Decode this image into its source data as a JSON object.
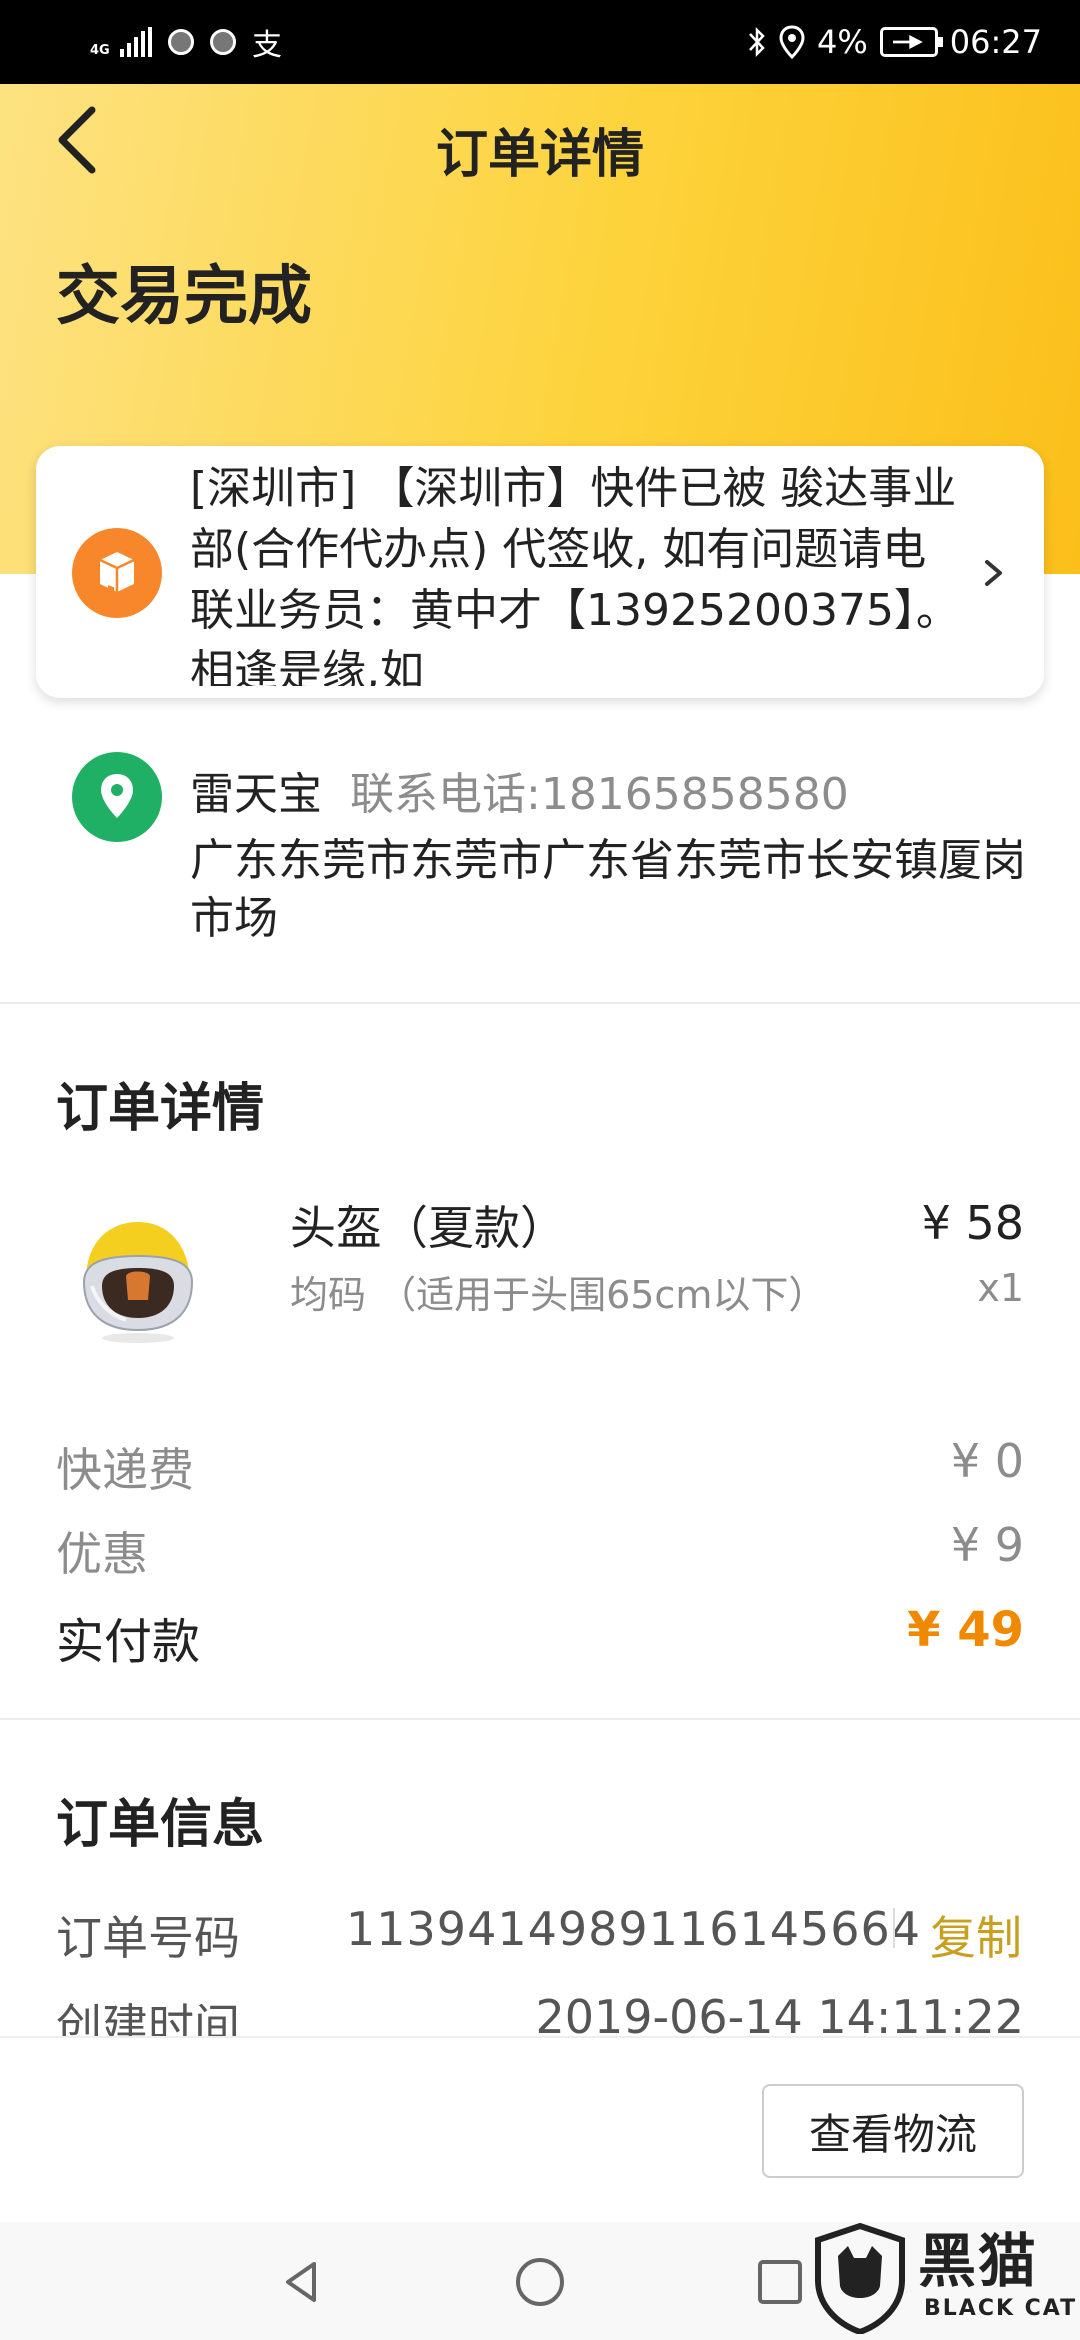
{
  "status_bar": {
    "network": "4G",
    "battery": "4%",
    "time": "06:27",
    "icons": [
      "signal-icon",
      "app-notification-icon",
      "app-notification-icon",
      "alipay-icon",
      "bluetooth-icon",
      "location-icon",
      "battery-icon"
    ]
  },
  "header": {
    "title": "订单详情",
    "status": "交易完成",
    "background_colors": [
      "#fde282",
      "#fbbf1a"
    ]
  },
  "logistics": {
    "text": "[深圳市] 【深圳市】快件已被 骏达事业部(合作代办点) 代签收, 如有问题请电联业务员：黄中才【13925200375】。相逢是缘,如",
    "icon": "package-box-icon",
    "icon_color": "#f7872a"
  },
  "address": {
    "name": "雷天宝",
    "phone": "联系电话:18165858580",
    "detail": "广东东莞市东莞市广东省东莞市长安镇厦岗市场",
    "icon": "location-pin-icon",
    "icon_color": "#1fb065"
  },
  "order_detail": {
    "section_title": "订单详情",
    "product": {
      "name": "头盔（夏款）",
      "spec": "均码 （适用于头围65cm以下）",
      "price": "¥ 58",
      "qty": "x1"
    },
    "shipping_label": "快递费",
    "shipping_value": "¥ 0",
    "discount_label": "优惠",
    "discount_value": "¥ 9",
    "paid_label": "实付款",
    "paid_value": "¥ 49",
    "accent_color": "#f08800"
  },
  "order_info": {
    "section_title": "订单信息",
    "order_no_label": "订单号码",
    "order_no": "1139414989116145664",
    "copy_label": "复制",
    "created_label": "创建时间",
    "created_value": "2019-06-14 14:11:22"
  },
  "actions": {
    "view_logistics": "查看物流"
  },
  "watermark": {
    "cn": "黑猫",
    "en": "BLACK CAT"
  }
}
